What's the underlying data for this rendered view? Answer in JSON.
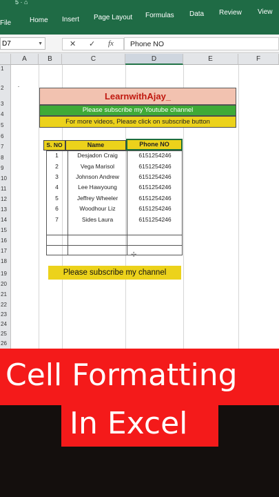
{
  "ribbon": {
    "qat": "5 · ⌂",
    "tabs": [
      "File",
      "Home",
      "Insert",
      "Page Layout",
      "Formulas",
      "Data",
      "Review",
      "View"
    ]
  },
  "formula_bar": {
    "name_box": "D7",
    "cancel": "✕",
    "enter": "✓",
    "fx": "fx",
    "content": "Phone NO"
  },
  "columns": [
    "A",
    "B",
    "C",
    "D",
    "E",
    "F"
  ],
  "rows": [
    "1",
    "2",
    "3",
    "4",
    "5",
    "6",
    "7",
    "8",
    "9",
    "10",
    "11",
    "12",
    "13",
    "14",
    "15",
    "16",
    "17",
    "18",
    "19",
    "20",
    "21",
    "22",
    "23",
    "24",
    "25",
    "26"
  ],
  "sheet": {
    "dot": "·",
    "title": "LearnwithAjay_",
    "subscribe_line": "Please subscribe my Youtube channel",
    "videos_line": "For more videos, Please click on subscribe button",
    "table_headers": [
      "S. NO",
      "Name",
      "Phone NO"
    ],
    "table_rows": [
      {
        "sno": "1",
        "name": "Desjadon Craig",
        "phone": "6151254246"
      },
      {
        "sno": "2",
        "name": "Vega Marisol",
        "phone": "6151254246"
      },
      {
        "sno": "3",
        "name": "Johnson Andrew",
        "phone": "6151254246"
      },
      {
        "sno": "4",
        "name": "Lee Hawyoung",
        "phone": "6151254246"
      },
      {
        "sno": "5",
        "name": "Jeffrey Wheeler",
        "phone": "6151254246"
      },
      {
        "sno": "6",
        "name": "Woodhour Liz",
        "phone": "6151254246"
      },
      {
        "sno": "7",
        "name": "Sides Laura",
        "phone": "6151254246"
      }
    ],
    "button_text": "Please subscribe my channel"
  },
  "overlay": {
    "line1": "Cell Formatting",
    "line2": "In Excel"
  },
  "colors": {
    "ribbon": "#1f6b45",
    "title_fill": "#f2c2b0",
    "title_text": "#c0180f",
    "green_fill": "#3faa37",
    "yellow_fill": "#ecd21b",
    "overlay_red": "#f41a1a"
  }
}
